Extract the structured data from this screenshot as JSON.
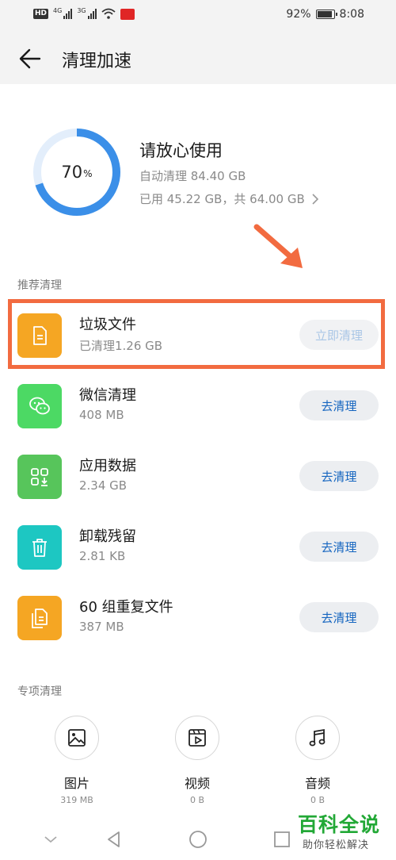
{
  "status_bar": {
    "hd": "HD",
    "net1": "4G",
    "net2": "3G",
    "battery": "92%",
    "time": "8:08"
  },
  "header": {
    "title": "清理加速"
  },
  "summary": {
    "percent": "70",
    "percent_unit": "%",
    "percent_value": 70,
    "title": "请放心使用",
    "auto_clean": "自动清理 84.40 GB",
    "usage": "已用 45.22 GB，共 64.00 GB"
  },
  "recommend": {
    "label": "推荐清理",
    "items": [
      {
        "name": "垃圾文件",
        "sub": "已清理1.26 GB",
        "action": "立即清理",
        "icon": "document-icon",
        "color": "#f5a623"
      },
      {
        "name": "微信清理",
        "sub": "408 MB",
        "action": "去清理",
        "icon": "wechat-icon",
        "color": "#4cd964"
      },
      {
        "name": "应用数据",
        "sub": "2.34 GB",
        "action": "去清理",
        "icon": "app-data-icon",
        "color": "#57c55b"
      },
      {
        "name": "卸载残留",
        "sub": "2.81 KB",
        "action": "去清理",
        "icon": "trash-icon",
        "color": "#1dc7c2"
      },
      {
        "name": "60 组重复文件",
        "sub": "387 MB",
        "action": "去清理",
        "icon": "duplicate-files-icon",
        "color": "#f5a623"
      }
    ]
  },
  "special": {
    "label": "专项清理",
    "items": [
      {
        "name": "图片",
        "size": "319 MB",
        "icon": "image-icon"
      },
      {
        "name": "视频",
        "size": "0 B",
        "icon": "video-icon"
      },
      {
        "name": "音频",
        "size": "0 B",
        "icon": "music-icon"
      }
    ]
  },
  "watermark": {
    "main": "百科全说",
    "sub": "助你轻松解决"
  },
  "colors": {
    "accent": "#3b8fe8",
    "track": "#e3eefb",
    "highlight": "#f26b40"
  }
}
